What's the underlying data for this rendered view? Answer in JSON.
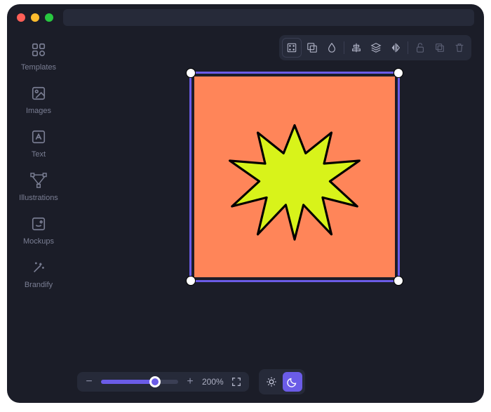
{
  "window": {
    "address_value": ""
  },
  "sidebar": {
    "items": [
      {
        "label": "Templates",
        "icon": "templates-icon"
      },
      {
        "label": "Images",
        "icon": "image-icon"
      },
      {
        "label": "Text",
        "icon": "text-icon"
      },
      {
        "label": "Illustrations",
        "icon": "illustrations-icon"
      },
      {
        "label": "Mockups",
        "icon": "mockups-icon"
      },
      {
        "label": "Brandify",
        "icon": "magic-wand-icon"
      }
    ]
  },
  "toolbar": {
    "groups": [
      {
        "items": [
          "grid-icon",
          "overlap-icon",
          "drop-icon"
        ]
      },
      {
        "items": [
          "align-icon",
          "layers-icon",
          "flip-icon"
        ]
      },
      {
        "items": [
          "lock-open-icon",
          "copy-icon",
          "trash-icon"
        ]
      }
    ]
  },
  "canvas": {
    "artboard_color": "#ff8559",
    "selection_color": "#6b5ce7",
    "shape": {
      "type": "starburst",
      "fill": "#d8f31a",
      "stroke": "#000000"
    }
  },
  "zoom": {
    "minus_label": "−",
    "plus_label": "+",
    "percent_label": "200%",
    "value": 200,
    "slider_fill_pct": 70
  },
  "theme": {
    "light_icon": "sun-icon",
    "dark_icon": "moon-icon",
    "active": "dark"
  }
}
